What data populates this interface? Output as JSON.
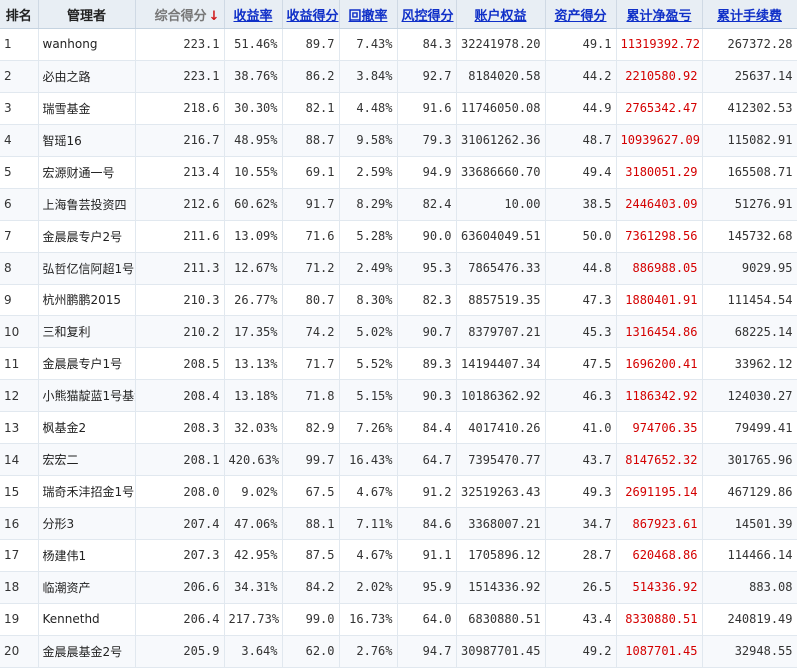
{
  "table": {
    "headers": {
      "rank": "排名",
      "manager": "管理者",
      "composite": "综合得分",
      "return_rate": "收益率",
      "return_score": "收益得分",
      "drawdown": "回撤率",
      "risk_score": "风控得分",
      "equity": "账户权益",
      "asset_score": "资产得分",
      "cum_pnl": "累计净盈亏",
      "cum_fee": "累计手续费"
    },
    "sort_arrow": "↓",
    "pnl_color": "#d40000",
    "link_color": "#1030c8",
    "rows": [
      {
        "rank": "1",
        "name": "wanhong",
        "composite": "223.1",
        "ret": "51.46%",
        "ret_score": "89.7",
        "dd": "7.43%",
        "risk": "84.3",
        "equity": "32241978.20",
        "asset": "49.1",
        "pnl": "11319392.72",
        "fee": "267372.28"
      },
      {
        "rank": "2",
        "name": "必由之路",
        "composite": "223.1",
        "ret": "38.76%",
        "ret_score": "86.2",
        "dd": "3.84%",
        "risk": "92.7",
        "equity": "8184020.58",
        "asset": "44.2",
        "pnl": "2210580.92",
        "fee": "25637.14"
      },
      {
        "rank": "3",
        "name": "瑞雪基金",
        "composite": "218.6",
        "ret": "30.30%",
        "ret_score": "82.1",
        "dd": "4.48%",
        "risk": "91.6",
        "equity": "11746050.08",
        "asset": "44.9",
        "pnl": "2765342.47",
        "fee": "412302.53"
      },
      {
        "rank": "4",
        "name": "智瑶16",
        "composite": "216.7",
        "ret": "48.95%",
        "ret_score": "88.7",
        "dd": "9.58%",
        "risk": "79.3",
        "equity": "31061262.36",
        "asset": "48.7",
        "pnl": "10939627.09",
        "fee": "115082.91"
      },
      {
        "rank": "5",
        "name": "宏源财通一号",
        "composite": "213.4",
        "ret": "10.55%",
        "ret_score": "69.1",
        "dd": "2.59%",
        "risk": "94.9",
        "equity": "33686660.70",
        "asset": "49.4",
        "pnl": "3180051.29",
        "fee": "165508.71"
      },
      {
        "rank": "6",
        "name": "上海鲁芸投资四",
        "composite": "212.6",
        "ret": "60.62%",
        "ret_score": "91.7",
        "dd": "8.29%",
        "risk": "82.4",
        "equity": "10.00",
        "asset": "38.5",
        "pnl": "2446403.09",
        "fee": "51276.91"
      },
      {
        "rank": "7",
        "name": "金晨晨专户2号",
        "composite": "211.6",
        "ret": "13.09%",
        "ret_score": "71.6",
        "dd": "5.28%",
        "risk": "90.0",
        "equity": "63604049.51",
        "asset": "50.0",
        "pnl": "7361298.56",
        "fee": "145732.68"
      },
      {
        "rank": "8",
        "name": "弘哲亿信阿超1号",
        "composite": "211.3",
        "ret": "12.67%",
        "ret_score": "71.2",
        "dd": "2.49%",
        "risk": "95.3",
        "equity": "7865476.33",
        "asset": "44.8",
        "pnl": "886988.05",
        "fee": "9029.95"
      },
      {
        "rank": "9",
        "name": "杭州鹏鹏2015",
        "composite": "210.3",
        "ret": "26.77%",
        "ret_score": "80.7",
        "dd": "8.30%",
        "risk": "82.3",
        "equity": "8857519.35",
        "asset": "47.3",
        "pnl": "1880401.91",
        "fee": "111454.54"
      },
      {
        "rank": "10",
        "name": "三和复利",
        "composite": "210.2",
        "ret": "17.35%",
        "ret_score": "74.2",
        "dd": "5.02%",
        "risk": "90.7",
        "equity": "8379707.21",
        "asset": "45.3",
        "pnl": "1316454.86",
        "fee": "68225.14"
      },
      {
        "rank": "11",
        "name": "金晨晨专户1号",
        "composite": "208.5",
        "ret": "13.13%",
        "ret_score": "71.7",
        "dd": "5.52%",
        "risk": "89.3",
        "equity": "14194407.34",
        "asset": "47.5",
        "pnl": "1696200.41",
        "fee": "33962.12"
      },
      {
        "rank": "12",
        "name": "小熊猫靛蓝1号基金",
        "composite": "208.4",
        "ret": "13.18%",
        "ret_score": "71.8",
        "dd": "5.15%",
        "risk": "90.3",
        "equity": "10186362.92",
        "asset": "46.3",
        "pnl": "1186342.92",
        "fee": "124030.27"
      },
      {
        "rank": "13",
        "name": "枫基金2",
        "composite": "208.3",
        "ret": "32.03%",
        "ret_score": "82.9",
        "dd": "7.26%",
        "risk": "84.4",
        "equity": "4017410.26",
        "asset": "41.0",
        "pnl": "974706.35",
        "fee": "79499.41"
      },
      {
        "rank": "14",
        "name": "宏宏二",
        "composite": "208.1",
        "ret": "420.63%",
        "ret_score": "99.7",
        "dd": "16.43%",
        "risk": "64.7",
        "equity": "7395470.77",
        "asset": "43.7",
        "pnl": "8147652.32",
        "fee": "301765.96"
      },
      {
        "rank": "15",
        "name": "瑞奇禾沣招金1号",
        "composite": "208.0",
        "ret": "9.02%",
        "ret_score": "67.5",
        "dd": "4.67%",
        "risk": "91.2",
        "equity": "32519263.43",
        "asset": "49.3",
        "pnl": "2691195.14",
        "fee": "467129.86"
      },
      {
        "rank": "16",
        "name": "分形3",
        "composite": "207.4",
        "ret": "47.06%",
        "ret_score": "88.1",
        "dd": "7.11%",
        "risk": "84.6",
        "equity": "3368007.21",
        "asset": "34.7",
        "pnl": "867923.61",
        "fee": "14501.39"
      },
      {
        "rank": "17",
        "name": "杨建伟1",
        "composite": "207.3",
        "ret": "42.95%",
        "ret_score": "87.5",
        "dd": "4.67%",
        "risk": "91.1",
        "equity": "1705896.12",
        "asset": "28.7",
        "pnl": "620468.86",
        "fee": "114466.14"
      },
      {
        "rank": "18",
        "name": "临潮资产",
        "composite": "206.6",
        "ret": "34.31%",
        "ret_score": "84.2",
        "dd": "2.02%",
        "risk": "95.9",
        "equity": "1514336.92",
        "asset": "26.5",
        "pnl": "514336.92",
        "fee": "883.08"
      },
      {
        "rank": "19",
        "name": "Kennethd",
        "composite": "206.4",
        "ret": "217.73%",
        "ret_score": "99.0",
        "dd": "16.73%",
        "risk": "64.0",
        "equity": "6830880.51",
        "asset": "43.4",
        "pnl": "8330880.51",
        "fee": "240819.49"
      },
      {
        "rank": "20",
        "name": "金晨晨基金2号",
        "composite": "205.9",
        "ret": "3.64%",
        "ret_score": "62.0",
        "dd": "2.76%",
        "risk": "94.7",
        "equity": "30987701.45",
        "asset": "49.2",
        "pnl": "1087701.45",
        "fee": "32948.55"
      }
    ]
  }
}
